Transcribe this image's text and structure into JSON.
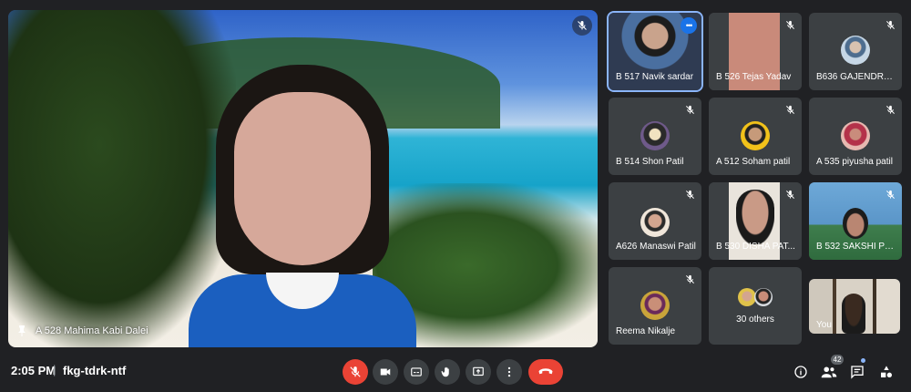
{
  "main_speaker": {
    "name": "A 528 Mahima Kabi Dalei"
  },
  "tiles": [
    {
      "name": "B 517 Navik sardar",
      "type": "video",
      "active": true
    },
    {
      "name": "B 526 Tejas Yadav",
      "type": "video"
    },
    {
      "name": "B636 GAJENDRA ...",
      "type": "avatar"
    },
    {
      "name": "B 514 Shon Patil",
      "type": "avatar"
    },
    {
      "name": "A 512 Soham patil",
      "type": "avatar"
    },
    {
      "name": "A 535 piyusha patil",
      "type": "avatar"
    },
    {
      "name": "A626 Manaswi Patil",
      "type": "avatar"
    },
    {
      "name": "B 530 DISHA PAT...",
      "type": "video"
    },
    {
      "name": "B 532 SAKSHI PH...",
      "type": "video"
    },
    {
      "name": "Reema Nikalje",
      "type": "avatar"
    },
    {
      "name": "30 others",
      "type": "others"
    },
    {
      "name": "You",
      "type": "video"
    }
  ],
  "toolbar": {
    "time": "2:05 PM",
    "separator": "|",
    "meeting_code": "fkg-tdrk-ntf",
    "participants_count": "42"
  },
  "colors": {
    "background": "#202124",
    "tile": "#3c4043",
    "danger": "#ea4335",
    "accent": "#1a73e8",
    "highlight": "#8ab4f8"
  }
}
